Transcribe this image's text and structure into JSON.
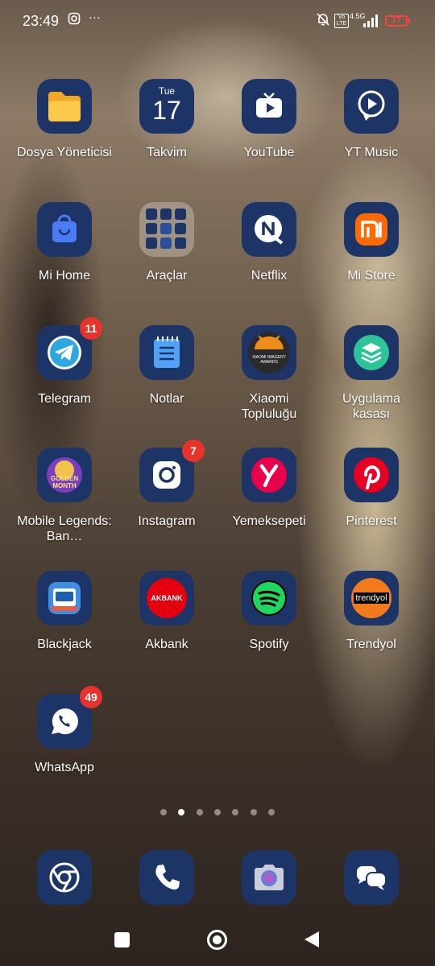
{
  "status_bar": {
    "time": "23:49",
    "network": "4.5G",
    "volte": "Vo LTE",
    "battery": "17",
    "more": "···"
  },
  "apps": [
    {
      "label": "Dosya Yöneticisi",
      "icon": "folder-icon"
    },
    {
      "label": "Takvim",
      "icon": "calendar-icon",
      "day": "Tue",
      "date": "17"
    },
    {
      "label": "YouTube",
      "icon": "youtube-icon"
    },
    {
      "label": "YT Music",
      "icon": "yt-music-icon"
    },
    {
      "label": "Mi Home",
      "icon": "mi-home-icon"
    },
    {
      "label": "Araçlar",
      "icon": "tools-folder-icon"
    },
    {
      "label": "Netflix",
      "icon": "netflix-icon"
    },
    {
      "label": "Mi Store",
      "icon": "mi-store-icon"
    },
    {
      "label": "Telegram",
      "icon": "telegram-icon",
      "badge": "11"
    },
    {
      "label": "Notlar",
      "icon": "notes-icon"
    },
    {
      "label": "Xiaomi Topluluğu",
      "icon": "xiaomi-community-icon",
      "icon_text": "XIAOMI IMAGERY AWARDS"
    },
    {
      "label": "Uygulama kasası",
      "icon": "app-vault-icon"
    },
    {
      "label": "Mobile Legends: Ban…",
      "icon": "mobile-legends-icon",
      "icon_text": "GOLDEN MONTH"
    },
    {
      "label": "Instagram",
      "icon": "instagram-icon",
      "badge": "7"
    },
    {
      "label": "Yemeksepeti",
      "icon": "yemeksepeti-icon"
    },
    {
      "label": "Pinterest",
      "icon": "pinterest-icon"
    },
    {
      "label": "Blackjack",
      "icon": "blackjack-icon"
    },
    {
      "label": "Akbank",
      "icon": "akbank-icon",
      "icon_text": "AKBANK"
    },
    {
      "label": "Spotify",
      "icon": "spotify-icon"
    },
    {
      "label": "Trendyol",
      "icon": "trendyol-icon",
      "icon_text": "trendyol"
    },
    {
      "label": "WhatsApp",
      "icon": "whatsapp-icon",
      "badge": "49"
    }
  ],
  "dock": [
    {
      "name": "chrome-icon"
    },
    {
      "name": "phone-icon"
    },
    {
      "name": "camera-icon"
    },
    {
      "name": "messages-icon"
    }
  ],
  "page_indicator": {
    "count": 7,
    "active_index": 1
  },
  "colors": {
    "icon_bg": "#1d3467",
    "badge": "#e8332a"
  }
}
